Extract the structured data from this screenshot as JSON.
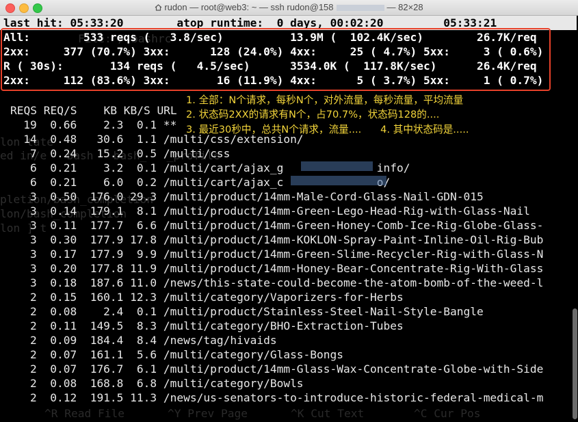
{
  "window": {
    "title": "rudon — root@web3: ~ — ssh rudon@158",
    "title_tail": "— 82×28"
  },
  "status": {
    "last_hit_label": "last hit:",
    "last_hit": "05:33:20",
    "runtime_label": "atop runtime:",
    "runtime": "0 days, 00:02:20",
    "clock": "05:33:21"
  },
  "summary": [
    "All:        533 reqs (   3.8/sec)          13.9M (  102.4K/sec)        26.7K/req",
    "2xx:     377 (70.7%) 3xx:      128 (24.0%) 4xx:     25 ( 4.7%) 5xx:     3 ( 0.6%)",
    "R ( 30s):       134 reqs (   4.5/sec)      3534.0K (  117.8K/sec)      26.4K/req",
    "2xx:     112 (83.6%) 3xx:       16 (11.9%) 4xx:      5 ( 3.7%) 5xx:     1 ( 0.7%)"
  ],
  "annotations": [
    "1. 全部：N个请求，每秒N个，对外流量，每秒流量，平均流量",
    "2. 状态码2XX的请求有N个，占70.7%，状态码128的....",
    "3. 最近30秒中，总共N个请求，流量....      4. 其中状态码是....."
  ],
  "table": {
    "headers": [
      "REQS",
      "REQ/S",
      "KB",
      "KB/S",
      "URL"
    ],
    "rows": [
      [
        "19",
        "0.66",
        "2.3",
        "0.1",
        "**"
      ],
      [
        "14",
        "0.48",
        "30.6",
        "1.1",
        "/multi/css/extension/"
      ],
      [
        "7",
        "0.24",
        "15.2",
        "0.5",
        "/multi/css"
      ],
      [
        "6",
        "0.21",
        "3.2",
        "0.1",
        "/multi/cart/ajax_g              info/"
      ],
      [
        "6",
        "0.21",
        "6.0",
        "0.2",
        "/multi/cart/ajax_c              o/"
      ],
      [
        "3",
        "0.50",
        "176.0",
        "29.3",
        "/multi/product/14mm-Male-Cord-Glass-Nail-GDN-015"
      ],
      [
        "3",
        "0.14",
        "179.1",
        "8.1",
        "/multi/product/14mm-Green-Lego-Head-Rig-with-Glass-Nail"
      ],
      [
        "3",
        "0.11",
        "177.7",
        "6.6",
        "/multi/product/14mm-Green-Honey-Comb-Ice-Rig-Globe-Glass-"
      ],
      [
        "3",
        "0.30",
        "177.9",
        "17.8",
        "/multi/product/14mm-KOKLON-Spray-Paint-Inline-Oil-Rig-Bub"
      ],
      [
        "3",
        "0.17",
        "177.9",
        "9.9",
        "/multi/product/14mm-Green-Slime-Recycler-Rig-with-Glass-N"
      ],
      [
        "3",
        "0.20",
        "177.8",
        "11.9",
        "/multi/product/14mm-Honey-Bear-Concentrate-Rig-With-Glass"
      ],
      [
        "3",
        "0.18",
        "187.6",
        "11.0",
        "/news/this-state-could-become-the-atom-bomb-of-the-weed-l"
      ],
      [
        "2",
        "0.15",
        "160.1",
        "12.3",
        "/multi/category/Vaporizers-for-Herbs"
      ],
      [
        "2",
        "0.08",
        "2.4",
        "0.1",
        "/multi/product/Stainless-Steel-Nail-Style-Bangle"
      ],
      [
        "2",
        "0.11",
        "149.5",
        "8.3",
        "/multi/category/BHO-Extraction-Tubes"
      ],
      [
        "2",
        "0.09",
        "184.4",
        "8.4",
        "/news/tag/hivaids"
      ],
      [
        "2",
        "0.07",
        "161.1",
        "5.6",
        "/multi/category/Glass-Bongs"
      ],
      [
        "2",
        "0.07",
        "176.7",
        "6.1",
        "/multi/product/14mm-Glass-Wax-Concentrate-Globe-with-Side"
      ],
      [
        "2",
        "0.08",
        "168.8",
        "6.8",
        "/multi/category/Bowls"
      ],
      [
        "2",
        "0.12",
        "191.5",
        "11.3",
        "/news/us-senators-to-introduce-historic-federal-medical-m"
      ]
    ]
  },
  "ghost_text": [
    "    File: /.bashrc",
    "lon tate",
    "ed in/e   bash   bash_   _profile",
    "pletion/bash_completion",
    "lon/bash_completion",
    "lon ] t"
  ],
  "footer_menu": [
    "^R Read File",
    "^Y Prev Page",
    "^K Cut Text",
    "^C Cur Pos"
  ]
}
